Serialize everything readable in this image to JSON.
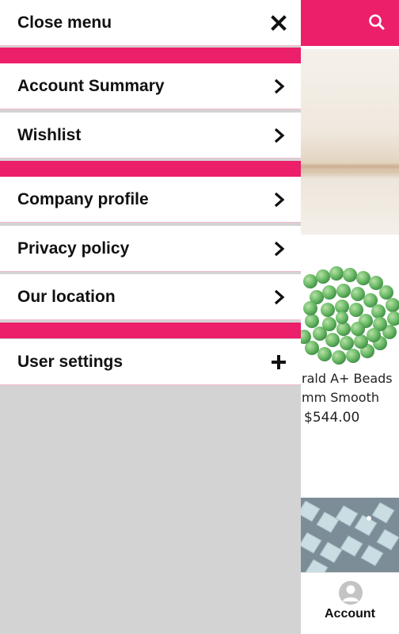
{
  "colors": {
    "accent": "#ec1f6a",
    "drawer_backdrop": "#d3d3d3"
  },
  "menu": {
    "close": {
      "label": "Close menu",
      "icon": "close-icon"
    },
    "sections": [
      [
        {
          "label": "Account Summary",
          "icon": "chevron-right-icon"
        },
        {
          "label": "Wishlist",
          "icon": "chevron-right-icon"
        }
      ],
      [
        {
          "label": "Company profile",
          "icon": "chevron-right-icon"
        },
        {
          "label": "Privacy policy",
          "icon": "chevron-right-icon"
        },
        {
          "label": "Our location",
          "icon": "chevron-right-icon"
        }
      ],
      [
        {
          "label": "User settings",
          "icon": "plus-icon"
        }
      ]
    ]
  },
  "background": {
    "header": {
      "search_icon": "search-icon"
    },
    "product": {
      "name_line1": "rald A+ Beads",
      "name_line2": "mm Smooth",
      "price": "$544.00"
    },
    "bottom_nav": {
      "account_label": "Account",
      "account_icon": "account-icon"
    }
  }
}
